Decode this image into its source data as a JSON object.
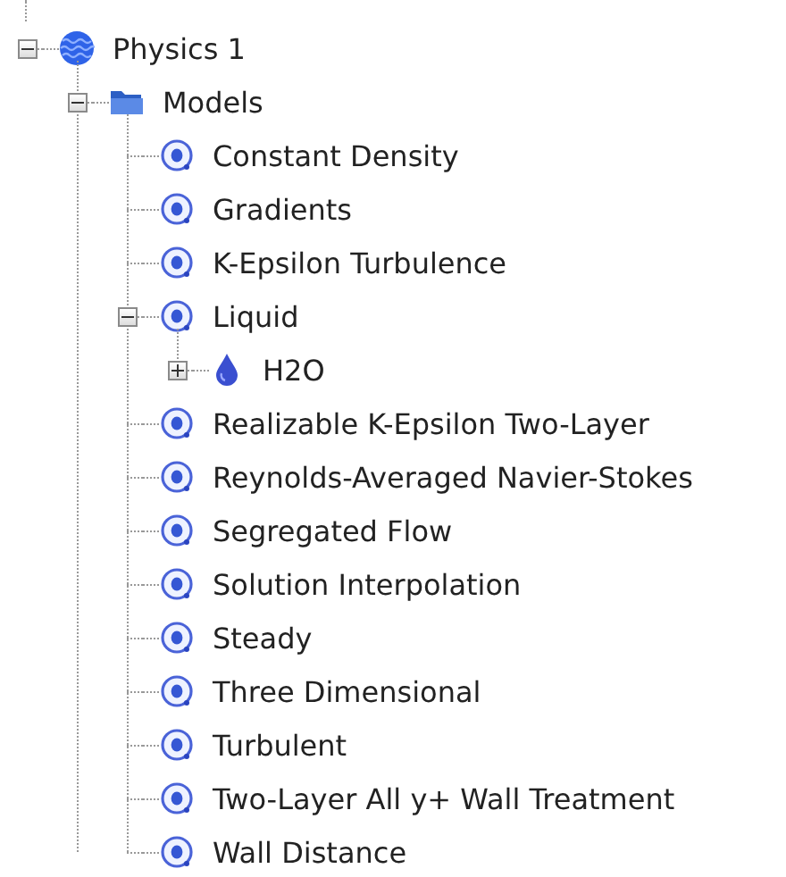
{
  "tree": [
    {
      "kind": "physics",
      "label": "Physics 1",
      "expanded": true,
      "children": [
        {
          "kind": "folder",
          "label": "Models",
          "expanded": true,
          "children": [
            {
              "kind": "model",
              "label": "Constant Density"
            },
            {
              "kind": "model",
              "label": "Gradients"
            },
            {
              "kind": "model",
              "label": "K-Epsilon Turbulence"
            },
            {
              "kind": "model",
              "label": "Liquid",
              "expanded": true,
              "children": [
                {
                  "kind": "material",
                  "label": "H2O",
                  "expanded": false
                }
              ]
            },
            {
              "kind": "model",
              "label": "Realizable K-Epsilon Two-Layer"
            },
            {
              "kind": "model",
              "label": "Reynolds-Averaged Navier-Stokes"
            },
            {
              "kind": "model",
              "label": "Segregated Flow"
            },
            {
              "kind": "model",
              "label": "Solution Interpolation"
            },
            {
              "kind": "model",
              "label": "Steady"
            },
            {
              "kind": "model",
              "label": "Three Dimensional"
            },
            {
              "kind": "model",
              "label": "Turbulent"
            },
            {
              "kind": "model",
              "label": "Two-Layer All y+ Wall Treatment"
            },
            {
              "kind": "model",
              "label": "Wall Distance"
            }
          ]
        }
      ]
    }
  ]
}
